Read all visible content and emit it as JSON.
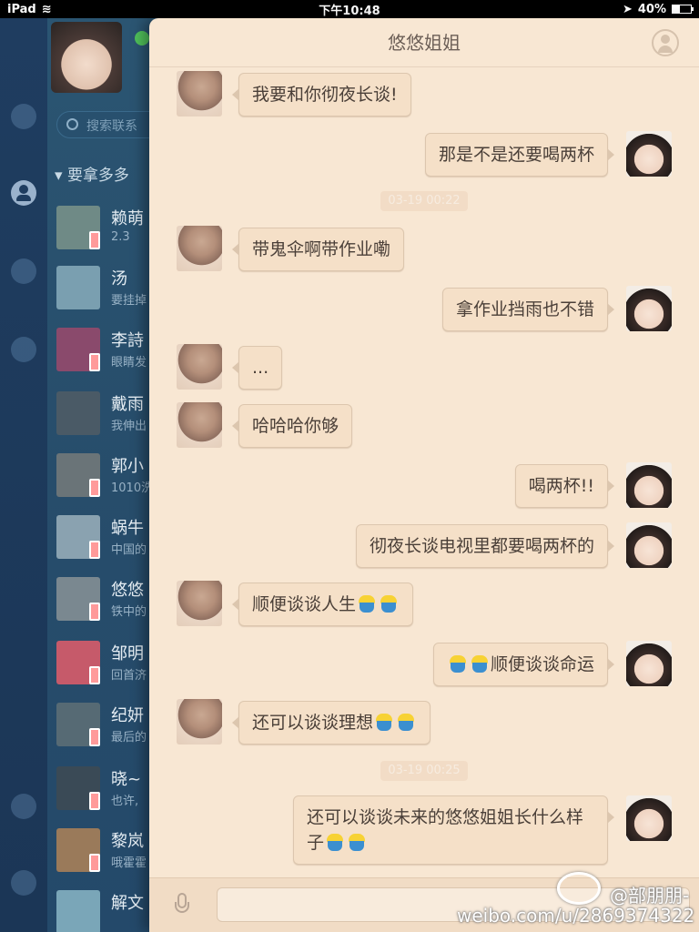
{
  "status_bar": {
    "device": "iPad",
    "time": "下午10:48",
    "battery": "40%",
    "battery_level": 0.4
  },
  "sidebar": {
    "search_placeholder": "搜索联系",
    "group_header": "要拿多多",
    "contacts": [
      {
        "name": "赖萌",
        "sub": "2.3"
      },
      {
        "name": "汤",
        "sub": "要挂掉"
      },
      {
        "name": "李詩",
        "sub": "眼睛发"
      },
      {
        "name": "戴雨",
        "sub": "我伸出"
      },
      {
        "name": "郭小",
        "sub": "1010洗"
      },
      {
        "name": "蜗牛",
        "sub": "中国的"
      },
      {
        "name": "悠悠",
        "sub": "铁中的"
      },
      {
        "name": "邹明",
        "sub": "回首济"
      },
      {
        "name": "纪妍",
        "sub": "最后的"
      },
      {
        "name": "晓~",
        "sub": "也许,"
      },
      {
        "name": "黎岚",
        "sub": "哦霍霍"
      },
      {
        "name": "解文",
        "sub": ""
      }
    ]
  },
  "chat": {
    "title": "悠悠姐姐",
    "messages": [
      {
        "side": "left",
        "text": "我要和你彻夜长谈!"
      },
      {
        "side": "right",
        "text": "那是不是还要喝两杯"
      },
      {
        "side": "left",
        "text": "带鬼伞啊带作业嘞"
      },
      {
        "side": "right",
        "text": "拿作业挡雨也不错"
      },
      {
        "side": "left",
        "text": "..."
      },
      {
        "side": "left",
        "text": "哈哈哈你够"
      },
      {
        "side": "right",
        "text": "喝两杯!!"
      },
      {
        "side": "right",
        "text": "彻夜长谈电视里都要喝两杯的"
      },
      {
        "side": "left",
        "text": "顺便谈谈人生"
      },
      {
        "side": "right",
        "text": "顺便谈谈命运"
      },
      {
        "side": "left",
        "text": "还可以谈谈理想"
      },
      {
        "side": "right",
        "text": "还可以谈谈未来的悠悠姐姐长什么样子"
      }
    ],
    "timestamps": [
      "03-19 00:22",
      "03-19 00:25"
    ]
  },
  "watermark": {
    "handle": "@部朋朋-",
    "url": "weibo.com/u/2869374322"
  }
}
